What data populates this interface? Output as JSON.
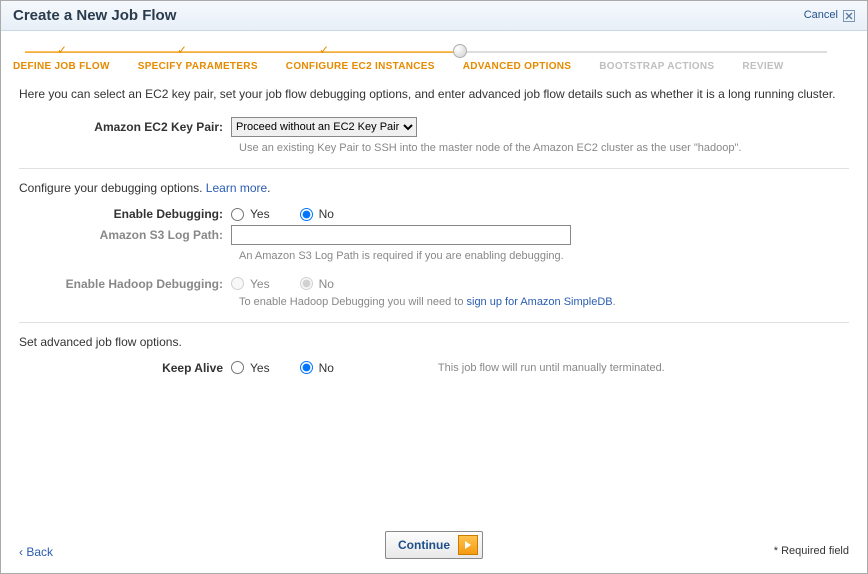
{
  "header": {
    "title": "Create a New Job Flow",
    "cancel": "Cancel"
  },
  "steps": [
    {
      "label": "DEFINE JOB FLOW",
      "state": "done"
    },
    {
      "label": "SPECIFY PARAMETERS",
      "state": "done"
    },
    {
      "label": "CONFIGURE EC2 INSTANCES",
      "state": "done"
    },
    {
      "label": "ADVANCED OPTIONS",
      "state": "current"
    },
    {
      "label": "BOOTSTRAP ACTIONS",
      "state": "future"
    },
    {
      "label": "REVIEW",
      "state": "future"
    }
  ],
  "intro": "Here you can select an EC2 key pair, set your job flow debugging options, and enter advanced job flow details such as whether it is a long running cluster.",
  "keypair": {
    "label": "Amazon EC2 Key Pair:",
    "selected": "Proceed without an EC2 Key Pair",
    "help": "Use an existing Key Pair to SSH into the master node of the Amazon EC2 cluster as the user \"hadoop\"."
  },
  "debug_section": {
    "intro": "Configure your debugging options. ",
    "learn_more": "Learn more",
    "enable_label": "Enable Debugging:",
    "yes": "Yes",
    "no": "No",
    "logpath_label": "Amazon S3 Log Path:",
    "logpath_value": "",
    "logpath_help": "An Amazon S3 Log Path is required if you are enabling debugging.",
    "hadoop_label": "Enable Hadoop Debugging:",
    "hadoop_help_prefix": "To enable Hadoop Debugging you will need to ",
    "hadoop_link": "sign up for Amazon SimpleDB"
  },
  "advanced_section": {
    "intro": "Set advanced job flow options.",
    "keepalive_label": "Keep Alive",
    "yes": "Yes",
    "no": "No",
    "note": "This job flow will run until manually terminated."
  },
  "footer": {
    "back": "Back",
    "continue": "Continue",
    "required": "* Required field"
  }
}
